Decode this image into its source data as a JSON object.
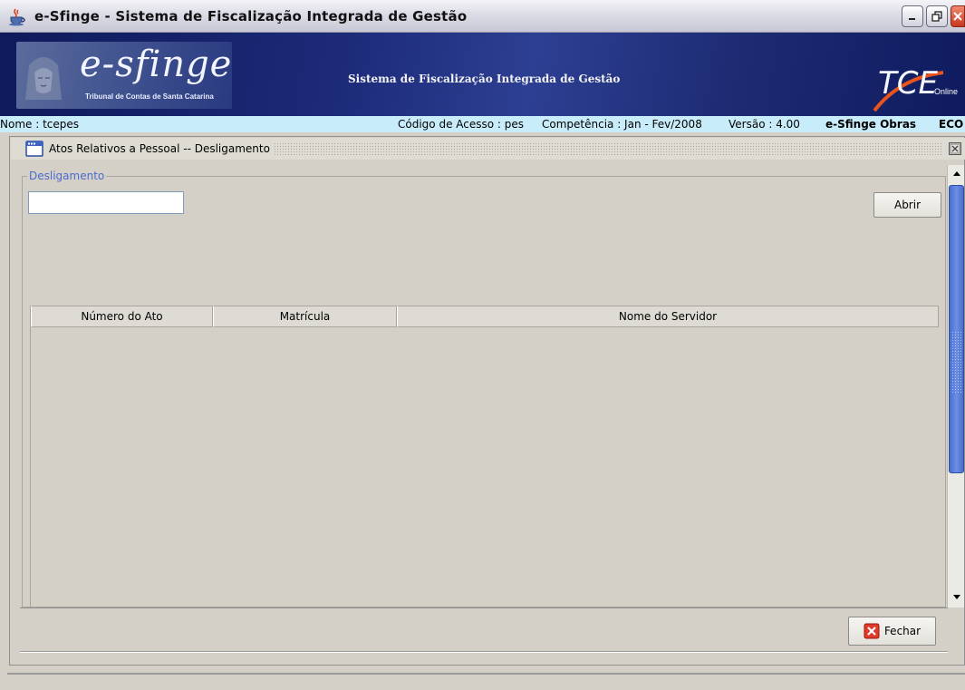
{
  "window": {
    "title": "e-Sfinge - Sistema de Fiscalização Integrada de Gestão",
    "controls": [
      "minimize",
      "restore",
      "close"
    ]
  },
  "banner": {
    "logo_text": "e-sfinge",
    "logo_subtitle": "Tribunal de Contas de Santa Catarina",
    "system_name": "Sistema de Fiscalização Integrada de Gestão",
    "tce_logo": "TCE",
    "tce_online": "Online"
  },
  "infobar": {
    "user": "Nome : tcepes",
    "access_code": "Código de Acesso : pes",
    "competence": "Competência : Jan - Fev/2008",
    "version": "Versão : 4.00",
    "module": "e-Sfinge Obras",
    "extra": "ECO"
  },
  "frame": {
    "title": "Atos Relativos a Pessoal -- Desligamento",
    "group_title": "Desligamento",
    "search_value": "",
    "open_button": "Abrir",
    "close_button": "Fechar",
    "table": {
      "columns": [
        "Número do Ato",
        "Matrícula",
        "Nome do Servidor"
      ],
      "rows": []
    }
  },
  "colors": {
    "banner_dark": "#0e1a5a",
    "infobar_bg": "#c9ecfa",
    "group_title": "#4a6bd0",
    "scroll_thumb": "#4a6fcc",
    "window_bg": "#d4d0c8"
  }
}
